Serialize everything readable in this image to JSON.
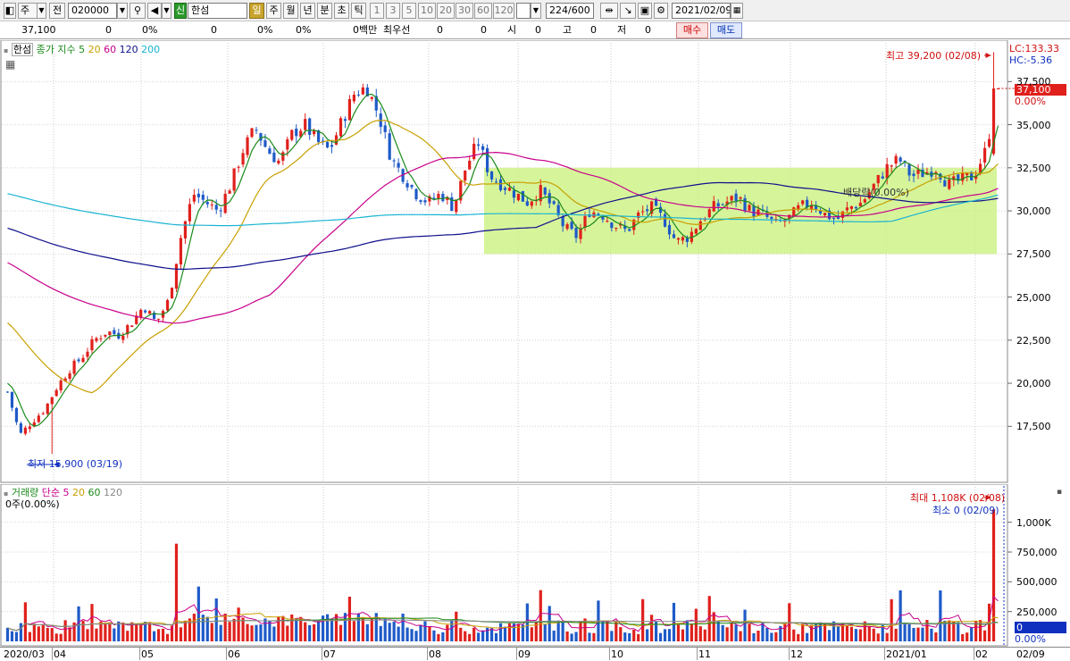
{
  "toolbar": {
    "type_label": "주",
    "all_label": "전",
    "code": "020000",
    "new_badge": "신",
    "name": "한섬",
    "periods": [
      "일",
      "주",
      "월",
      "년",
      "분",
      "초",
      "틱"
    ],
    "active_period": "일",
    "minute_options": [
      "1",
      "3",
      "5",
      "10",
      "20",
      "30",
      "60",
      "120"
    ],
    "count": "224",
    "count_max": "/600",
    "date": "2021/02/09"
  },
  "quote": {
    "price": "37,100",
    "change": "0",
    "change_pct": "0%",
    "volume": "0",
    "volume_pct": "0%",
    "amount": "0백만",
    "best_label": "최우선",
    "best1": "0",
    "best2": "0",
    "open_label": "시",
    "open": "0",
    "high_label": "고",
    "high": "0",
    "low_label": "저",
    "low": "0",
    "buy_label": "매수",
    "sell_label": "매도"
  },
  "price_panel": {
    "legend": {
      "name": "한섬",
      "type": "종가 지수",
      "ma": [
        {
          "period": "5",
          "color": "#1a8a1a"
        },
        {
          "period": "20",
          "color": "#c8a000"
        },
        {
          "period": "60",
          "color": "#c8008c"
        },
        {
          "period": "120",
          "color": "#10108c"
        },
        {
          "period": "200",
          "color": "#1ab4d2"
        }
      ]
    },
    "lc_label": "LC:133.33",
    "hc_label": "HC:-5.36",
    "high_note": "최고 39,200 (02/08)",
    "low_note": "최저 15,900 (03/19)",
    "dividend_note": "배당락(0.00%)",
    "current_tag": "37,100",
    "current_pct": "0.00%",
    "yticks": [
      "37,500",
      "35,000",
      "32,500",
      "30,000",
      "27,500",
      "25,000",
      "22,500",
      "20,000",
      "17,500"
    ],
    "colors": {
      "up": "#e0201c",
      "down": "#1e5ac8",
      "box": "#c8f078"
    }
  },
  "volume_panel": {
    "legend": {
      "name": "거래량",
      "type": "단순",
      "ma": [
        {
          "period": "5",
          "color": "#c8008c"
        },
        {
          "period": "20",
          "color": "#c8a000"
        },
        {
          "period": "60",
          "color": "#1a8a1a"
        },
        {
          "period": "120",
          "color": "#888888"
        }
      ]
    },
    "sub_label": "0주(0.00%)",
    "max_note": "최대 1,108K (02/08)",
    "min_note": "최소 0 (02/09)",
    "yticks": [
      "1,000K",
      "750,000",
      "500,000",
      "250,000"
    ],
    "zero_tag": "0",
    "zero_pct": "0.00%"
  },
  "xaxis": [
    "2020/03",
    "04",
    "05",
    "06",
    "07",
    "08",
    "09",
    "10",
    "11",
    "12",
    "2021/01",
    "02",
    "02/09"
  ],
  "chart_data": {
    "type": "candlestick",
    "title": "한섬",
    "x_range": [
      "2020/03",
      "2021/02/09"
    ],
    "y_range": [
      15000,
      40000
    ],
    "closes_approx": [
      19500,
      17000,
      17800,
      18500,
      19800,
      20800,
      21500,
      22500,
      23000,
      22800,
      23500,
      24500,
      23500,
      24800,
      28500,
      31000,
      30500,
      30000,
      31500,
      33500,
      34800,
      33500,
      32800,
      34500,
      35000,
      34000,
      33500,
      35200,
      36800,
      37200,
      35500,
      33000,
      32000,
      31000,
      30500,
      31000,
      30200,
      32500,
      34000,
      32000,
      31500,
      31000,
      30500,
      31200,
      30200,
      29000,
      28500,
      30000,
      29800,
      29200,
      28800,
      29800,
      30200,
      29500,
      28200,
      28500,
      29500,
      30200,
      30500,
      30800,
      30000,
      29800,
      29200,
      29500,
      30200,
      30500,
      29800,
      29500,
      30200,
      30500,
      31500,
      32500,
      33000,
      32000,
      32200,
      32500,
      31500,
      31800,
      32000,
      33500,
      37100
    ],
    "volume_max": "1,108K"
  }
}
